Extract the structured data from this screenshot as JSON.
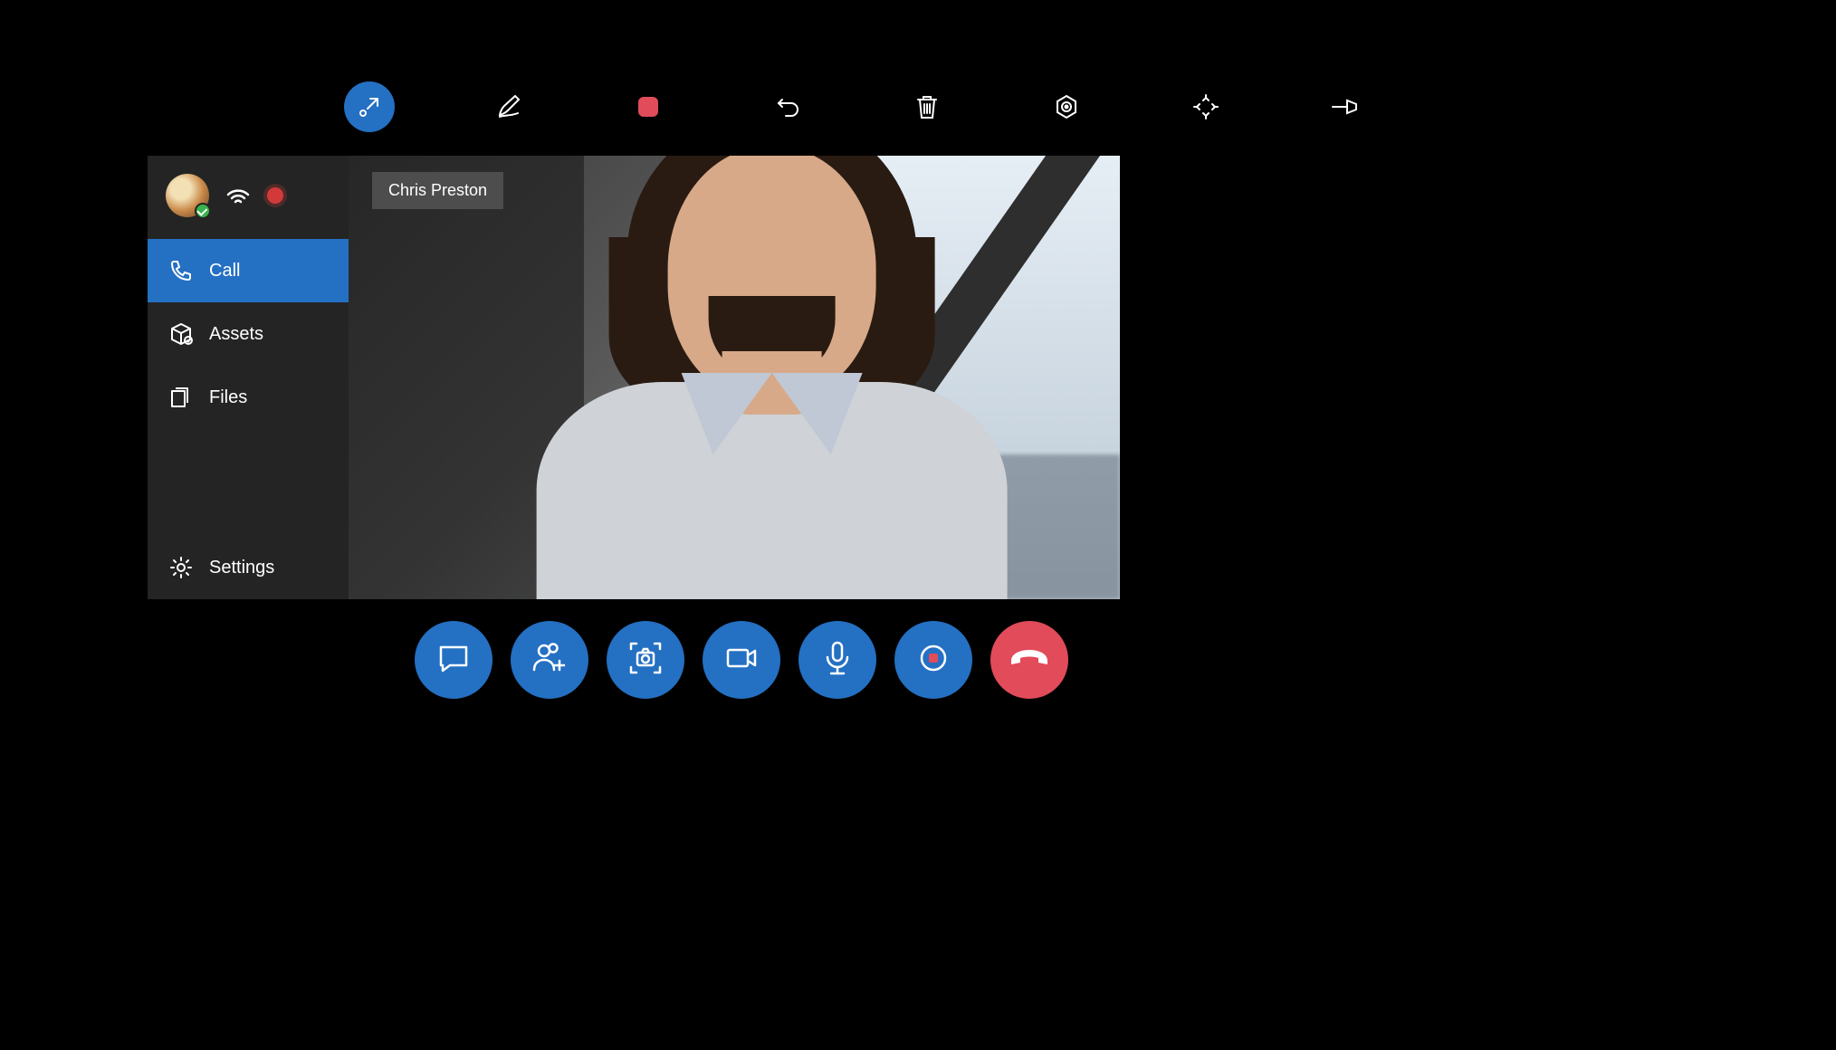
{
  "colors": {
    "accent": "#2470c3",
    "end_call": "#e14b5a",
    "record": "#d23a3a"
  },
  "topbar": {
    "items": [
      {
        "icon": "collapse-arrow-icon",
        "active": true
      },
      {
        "icon": "pen-icon",
        "active": false
      },
      {
        "icon": "square-record-icon",
        "active": false
      },
      {
        "icon": "undo-icon",
        "active": false
      },
      {
        "icon": "trash-icon",
        "active": false
      },
      {
        "icon": "target-icon",
        "active": false
      },
      {
        "icon": "expand-icon",
        "active": false
      },
      {
        "icon": "pin-icon",
        "active": false
      }
    ]
  },
  "sidebar": {
    "user": {
      "presence": "available",
      "recording": true
    },
    "items": [
      {
        "icon": "phone-icon",
        "label": "Call",
        "active": true
      },
      {
        "icon": "package-icon",
        "label": "Assets",
        "active": false
      },
      {
        "icon": "files-icon",
        "label": "Files",
        "active": false
      }
    ],
    "footer": {
      "icon": "gear-icon",
      "label": "Settings"
    }
  },
  "video": {
    "participant_name": "Chris Preston"
  },
  "callbar": {
    "items": [
      {
        "icon": "chat-icon"
      },
      {
        "icon": "add-person-icon"
      },
      {
        "icon": "camera-capture-icon"
      },
      {
        "icon": "video-icon"
      },
      {
        "icon": "mic-icon"
      },
      {
        "icon": "record-icon"
      }
    ],
    "end": {
      "icon": "hangup-icon"
    }
  }
}
